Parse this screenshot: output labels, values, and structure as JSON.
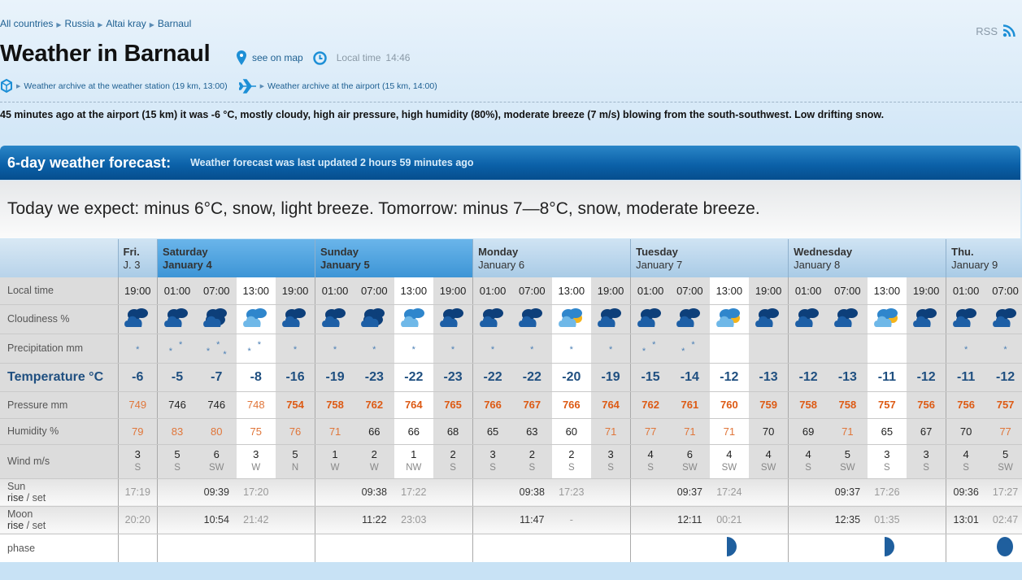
{
  "breadcrumb": [
    "All countries",
    "Russia",
    "Altai kray",
    "Barnaul"
  ],
  "rss": "RSS",
  "title": "Weather in Barnaul",
  "see_on_map": "see on map",
  "local_time_label": "Local time",
  "local_time": "14:46",
  "archive_station": "Weather archive at the weather station (19 km, 13:00)",
  "archive_airport": "Weather archive at the airport (15 km, 14:00)",
  "current": "45 minutes ago at the airport (15 km) it was -6 °C, mostly cloudy, high air pressure, high humidity (80%), moderate breeze (7 m/s) blowing from the south-southwest. Low drifting snow.",
  "forecast": {
    "title": "6-day weather forecast:",
    "updated": "Weather forecast was last updated 2 hours 59 minutes ago",
    "summary": "Today we expect: minus 6°C, snow, light breeze. Tomorrow: minus 7—8°C, snow, moderate breeze.",
    "row_labels": {
      "local_time": "Local time",
      "cloudiness": "Cloudiness %",
      "precipitation": "Precipitation mm",
      "temperature": "Temperature °C",
      "pressure": "Pressure mm",
      "humidity": "Humidity %",
      "wind": "Wind m/s",
      "sun": "Sun",
      "moon": "Moon",
      "rise": "rise",
      "set": "set",
      "phase": "phase"
    },
    "days": [
      {
        "name": "Fri.",
        "date": "J. 3",
        "cols": 1,
        "weekend": false
      },
      {
        "name": "Saturday",
        "date": "January 4",
        "cols": 4,
        "weekend": true
      },
      {
        "name": "Sunday",
        "date": "January 5",
        "cols": 4,
        "weekend": true
      },
      {
        "name": "Monday",
        "date": "January 6",
        "cols": 4,
        "weekend": false
      },
      {
        "name": "Tuesday",
        "date": "January 7",
        "cols": 4,
        "weekend": false
      },
      {
        "name": "Wednesday",
        "date": "January 8",
        "cols": 4,
        "weekend": false
      },
      {
        "name": "Thu.",
        "date": "January 9",
        "cols": 2,
        "weekend": false
      }
    ],
    "columns": [
      {
        "time": "19:00",
        "cloud": "cloudy-night",
        "snow": 1,
        "temp": "-6",
        "pressure": "749",
        "p_level": "light",
        "humidity": "79",
        "h_level": "light",
        "wind": "3",
        "dir": "S",
        "sun": "17:19",
        "sun_type": "set",
        "moon": "20:20",
        "moon_type": "set",
        "phase": "crescent"
      },
      {
        "time": "01:00",
        "cloud": "cloudy-night",
        "snow": 2,
        "temp": "-5",
        "pressure": "746",
        "p_level": "normal",
        "humidity": "83",
        "h_level": "light",
        "wind": "5",
        "dir": "S",
        "sun": "",
        "moon": "",
        "phase": ""
      },
      {
        "time": "07:00",
        "cloud": "overcast",
        "snow": 3,
        "temp": "-7",
        "pressure": "746",
        "p_level": "normal",
        "humidity": "80",
        "h_level": "light",
        "wind": "6",
        "dir": "SW",
        "sun": "09:39",
        "sun_type": "rise",
        "moon": "10:54",
        "moon_type": "rise",
        "phase": ""
      },
      {
        "time": "13:00",
        "cloud": "overcast-day",
        "snow": 2,
        "temp": "-8",
        "pressure": "748",
        "p_level": "light",
        "humidity": "75",
        "h_level": "light",
        "wind": "3",
        "dir": "W",
        "sun": "17:20",
        "sun_type": "set",
        "moon": "21:42",
        "moon_type": "set",
        "phase": "crescent"
      },
      {
        "time": "19:00",
        "cloud": "cloudy-night",
        "snow": 1,
        "temp": "-16",
        "pressure": "754",
        "p_level": "high",
        "humidity": "76",
        "h_level": "light",
        "wind": "5",
        "dir": "N",
        "sun": "",
        "moon": "",
        "phase": ""
      },
      {
        "time": "01:00",
        "cloud": "cloudy-night",
        "snow": 1,
        "temp": "-19",
        "pressure": "758",
        "p_level": "high",
        "humidity": "71",
        "h_level": "light",
        "wind": "1",
        "dir": "W",
        "sun": "",
        "moon": "",
        "phase": ""
      },
      {
        "time": "07:00",
        "cloud": "overcast",
        "snow": 1,
        "temp": "-23",
        "pressure": "762",
        "p_level": "high",
        "humidity": "66",
        "h_level": "normal",
        "wind": "2",
        "dir": "W",
        "sun": "09:38",
        "sun_type": "rise",
        "moon": "11:22",
        "moon_type": "rise",
        "phase": ""
      },
      {
        "time": "13:00",
        "cloud": "overcast-day",
        "snow": 1,
        "temp": "-22",
        "pressure": "764",
        "p_level": "high",
        "humidity": "66",
        "h_level": "normal",
        "wind": "1",
        "dir": "NW",
        "sun": "17:22",
        "sun_type": "set",
        "moon": "23:03",
        "moon_type": "set",
        "phase": "crescent"
      },
      {
        "time": "19:00",
        "cloud": "cloudy-night",
        "snow": 1,
        "temp": "-23",
        "pressure": "765",
        "p_level": "high",
        "humidity": "68",
        "h_level": "normal",
        "wind": "2",
        "dir": "S",
        "sun": "",
        "moon": "",
        "phase": ""
      },
      {
        "time": "01:00",
        "cloud": "cloudy-night",
        "snow": 1,
        "temp": "-22",
        "pressure": "766",
        "p_level": "high",
        "humidity": "65",
        "h_level": "normal",
        "wind": "3",
        "dir": "S",
        "sun": "",
        "moon": "",
        "phase": ""
      },
      {
        "time": "07:00",
        "cloud": "cloudy-night",
        "snow": 1,
        "temp": "-22",
        "pressure": "767",
        "p_level": "high",
        "humidity": "63",
        "h_level": "normal",
        "wind": "2",
        "dir": "S",
        "sun": "09:38",
        "sun_type": "rise",
        "moon": "11:47",
        "moon_type": "rise",
        "phase": ""
      },
      {
        "time": "13:00",
        "cloud": "partly-sunny",
        "snow": 1,
        "temp": "-20",
        "pressure": "766",
        "p_level": "high",
        "humidity": "60",
        "h_level": "normal",
        "wind": "2",
        "dir": "S",
        "sun": "17:23",
        "sun_type": "set",
        "moon": "-",
        "moon_type": "set",
        "phase": "crescent"
      },
      {
        "time": "19:00",
        "cloud": "cloudy-night",
        "snow": 1,
        "temp": "-19",
        "pressure": "764",
        "p_level": "high",
        "humidity": "71",
        "h_level": "light",
        "wind": "3",
        "dir": "S",
        "sun": "",
        "moon": "",
        "phase": ""
      },
      {
        "time": "01:00",
        "cloud": "cloudy-night",
        "snow": 2,
        "temp": "-15",
        "pressure": "762",
        "p_level": "high",
        "humidity": "77",
        "h_level": "light",
        "wind": "4",
        "dir": "S",
        "sun": "",
        "moon": "",
        "phase": ""
      },
      {
        "time": "07:00",
        "cloud": "cloudy-night",
        "snow": 2,
        "temp": "-14",
        "pressure": "761",
        "p_level": "high",
        "humidity": "71",
        "h_level": "light",
        "wind": "6",
        "dir": "SW",
        "sun": "09:37",
        "sun_type": "rise",
        "moon": "12:11",
        "moon_type": "rise",
        "phase": ""
      },
      {
        "time": "13:00",
        "cloud": "partly-sunny",
        "snow": 0,
        "temp": "-12",
        "pressure": "760",
        "p_level": "high",
        "humidity": "71",
        "h_level": "light",
        "wind": "4",
        "dir": "SW",
        "sun": "17:24",
        "sun_type": "set",
        "moon": "00:21",
        "moon_type": "set",
        "phase": "half"
      },
      {
        "time": "19:00",
        "cloud": "cloudy-night",
        "snow": 0,
        "temp": "-13",
        "pressure": "759",
        "p_level": "high",
        "humidity": "70",
        "h_level": "normal",
        "wind": "4",
        "dir": "SW",
        "sun": "",
        "moon": "",
        "phase": ""
      },
      {
        "time": "01:00",
        "cloud": "cloudy-night",
        "snow": 0,
        "temp": "-12",
        "pressure": "758",
        "p_level": "high",
        "humidity": "69",
        "h_level": "normal",
        "wind": "4",
        "dir": "S",
        "sun": "",
        "moon": "",
        "phase": ""
      },
      {
        "time": "07:00",
        "cloud": "cloudy-night",
        "snow": 0,
        "temp": "-13",
        "pressure": "758",
        "p_level": "high",
        "humidity": "71",
        "h_level": "light",
        "wind": "5",
        "dir": "SW",
        "sun": "09:37",
        "sun_type": "rise",
        "moon": "12:35",
        "moon_type": "rise",
        "phase": ""
      },
      {
        "time": "13:00",
        "cloud": "partly-sunny",
        "snow": 0,
        "temp": "-11",
        "pressure": "757",
        "p_level": "high",
        "humidity": "65",
        "h_level": "normal",
        "wind": "3",
        "dir": "S",
        "sun": "17:26",
        "sun_type": "set",
        "moon": "01:35",
        "moon_type": "set",
        "phase": "half"
      },
      {
        "time": "19:00",
        "cloud": "cloudy-night",
        "snow": 0,
        "temp": "-12",
        "pressure": "756",
        "p_level": "high",
        "humidity": "67",
        "h_level": "normal",
        "wind": "3",
        "dir": "S",
        "sun": "",
        "moon": "",
        "phase": ""
      },
      {
        "time": "01:00",
        "cloud": "partly-cloudy-night",
        "snow": 1,
        "temp": "-11",
        "pressure": "756",
        "p_level": "high",
        "humidity": "70",
        "h_level": "normal",
        "wind": "4",
        "dir": "S",
        "sun": "09:36",
        "sun_type": "rise",
        "moon": "13:01",
        "moon_type": "rise",
        "phase": ""
      },
      {
        "time": "07:00",
        "cloud": "cloudy-night",
        "snow": 1,
        "temp": "-12",
        "pressure": "757",
        "p_level": "high",
        "humidity": "77",
        "h_level": "light",
        "wind": "5",
        "dir": "SW",
        "sun": "17:27",
        "sun_type": "set",
        "moon": "02:47",
        "moon_type": "set",
        "phase": "gibbous"
      }
    ]
  },
  "colors": {
    "link": "#1d5f91",
    "header_bar": "#0a5fa6",
    "weekend_header": "#3d95d6",
    "temperature": "#1f4f80",
    "pressure_high": "#dd5a14",
    "icon_blue": "#1d5fa6"
  }
}
